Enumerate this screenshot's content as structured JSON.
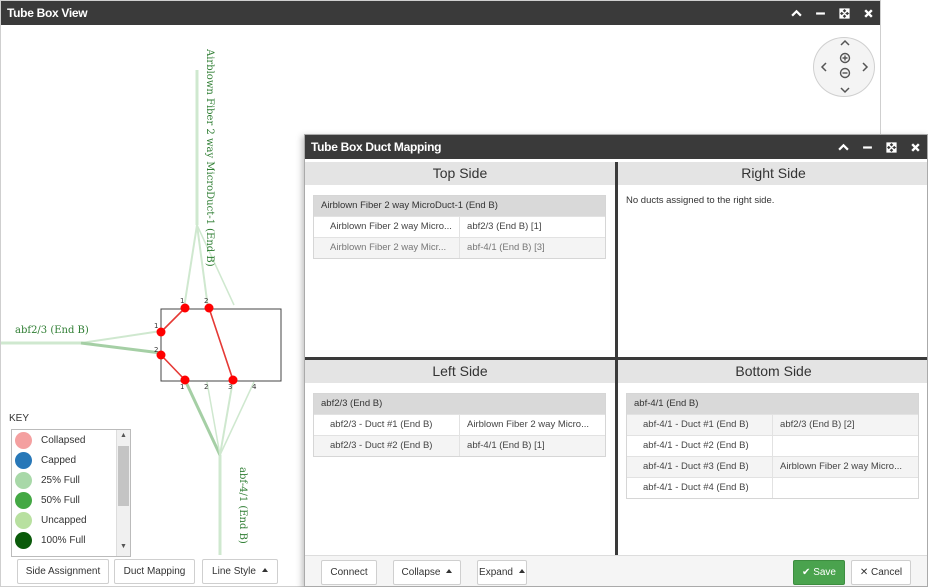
{
  "main_window": {
    "title": "Tube Box View"
  },
  "canvas": {
    "labels": {
      "top_duct": "Airblown Fiber 2 way MicroDuct-1 (End B)",
      "left_duct": "abf2/3 (End B)",
      "bottom_duct": "abf-4/1 (End B)"
    },
    "port_numbers": {
      "top": [
        "1",
        "2"
      ],
      "left": [
        "1",
        "2"
      ],
      "bottom": [
        "1",
        "2",
        "3",
        "4"
      ]
    },
    "colors": {
      "connection": "#e53935",
      "port": "#ff0000",
      "duct_line": "#a5d6a7",
      "label": "#2e7d32"
    }
  },
  "key": {
    "title": "KEY",
    "items": [
      {
        "label": "Collapsed",
        "color": "#f4a0a0"
      },
      {
        "label": "Capped",
        "color": "#2878b8"
      },
      {
        "label": "25% Full",
        "color": "#a8d8a8"
      },
      {
        "label": "50% Full",
        "color": "#44a844"
      },
      {
        "label": "Uncapped",
        "color": "#b8e0a0"
      },
      {
        "label": "100% Full",
        "color": "#0a5a0a"
      }
    ]
  },
  "toolbar": {
    "side_assignment": "Side Assignment",
    "duct_mapping": "Duct Mapping",
    "line_style": "Line Style"
  },
  "dialog": {
    "title": "Tube Box Duct Mapping",
    "top_side": {
      "header": "Top Side",
      "group": "Airblown Fiber 2 way MicroDuct-1 (End B)",
      "rows": [
        [
          "Airblown Fiber 2 way Micro...",
          "abf2/3 (End B) [1]"
        ],
        [
          "Airblown Fiber 2 way Micr...",
          "abf-4/1 (End B) [3]"
        ]
      ]
    },
    "right_side": {
      "header": "Right Side",
      "note": "No ducts assigned to the right side."
    },
    "left_side": {
      "header": "Left Side",
      "group": "abf2/3 (End B)",
      "rows": [
        [
          "abf2/3 - Duct #1 (End B)",
          "Airblown Fiber 2 way Micro..."
        ],
        [
          "abf2/3 - Duct #2 (End B)",
          "abf-4/1 (End B) [1]"
        ]
      ]
    },
    "bottom_side": {
      "header": "Bottom Side",
      "group": "abf-4/1 (End B)",
      "rows": [
        [
          "abf-4/1 - Duct #1 (End B)",
          "abf2/3 (End B) [2]"
        ],
        [
          "abf-4/1 - Duct #2 (End B)",
          ""
        ],
        [
          "abf-4/1 - Duct #3 (End B)",
          "Airblown Fiber 2 way Micro..."
        ],
        [
          "abf-4/1 - Duct #4 (End B)",
          ""
        ]
      ]
    },
    "footer": {
      "connect": "Connect",
      "collapse": "Collapse",
      "expand": "Expand",
      "save": "Save",
      "cancel": "Cancel"
    }
  }
}
